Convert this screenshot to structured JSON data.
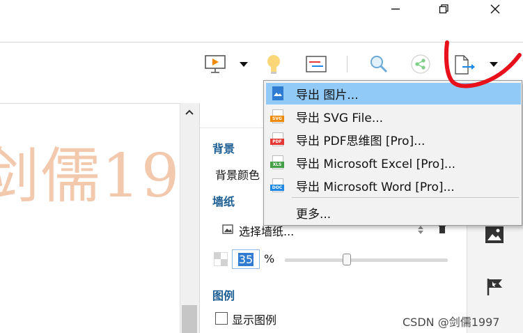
{
  "window": {
    "minimize_icon": "minimize-icon",
    "restore_icon": "restore-icon",
    "close_icon": "close-icon"
  },
  "toolbar": {
    "icons": [
      "presentation-icon",
      "chevron-down-icon",
      "lightbulb-icon",
      "outline-icon",
      "search-icon",
      "share-icon",
      "export-icon",
      "chevron-down-icon"
    ]
  },
  "canvas": {
    "watermark_text": "剑儒19"
  },
  "panel": {
    "background_section": "背景",
    "background_color_label": "背景颜色",
    "wallpaper_section": "墙纸",
    "choose_wallpaper_label": "选择墙纸...",
    "opacity_value": "35",
    "opacity_unit": "%",
    "opacity_slider": 0.38,
    "legend_section": "图例",
    "show_legend_label": "显示图例"
  },
  "export_menu": {
    "items": [
      {
        "label": "导出 图片...",
        "icon": "image-file-icon",
        "highlighted": true
      },
      {
        "label": "导出 SVG File...",
        "icon": "svg-file-icon"
      },
      {
        "label": "导出 PDF思维图 [Pro]...",
        "icon": "pdf-file-icon"
      },
      {
        "label": "导出 Microsoft Excel [Pro]...",
        "icon": "xls-file-icon"
      },
      {
        "label": "导出 Microsoft Word [Pro]...",
        "icon": "doc-file-icon"
      }
    ],
    "more_label": "更多..."
  },
  "colors": {
    "accent_blue": "#1d5e93",
    "menu_highlight": "#91c9f7",
    "annotation_red": "#e8101a",
    "watermark": "#f3c9ae"
  },
  "footer": {
    "watermark": "CSDN @剑儒1997"
  }
}
